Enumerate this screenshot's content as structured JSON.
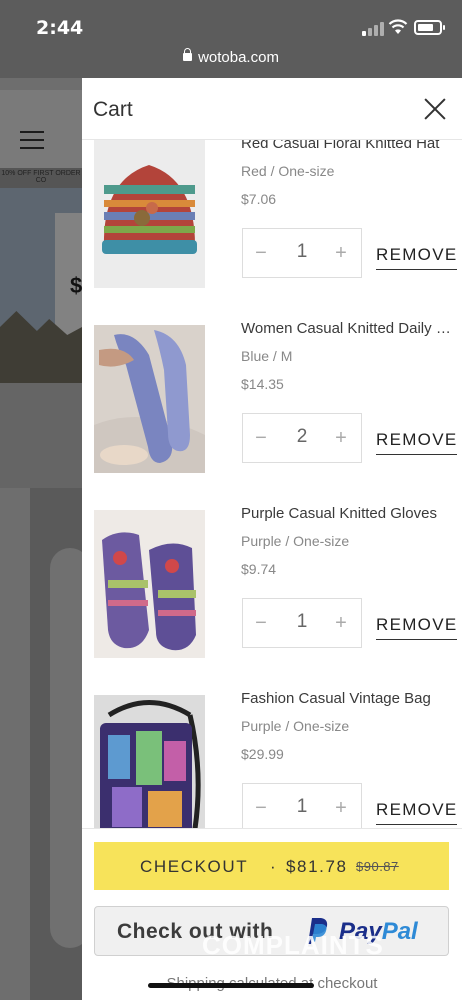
{
  "status": {
    "time": "2:44",
    "url": "wotoba.com"
  },
  "background": {
    "promo": "10% OFF FIRST ORDER CO",
    "hero_symbol": "$"
  },
  "cart": {
    "title": "Cart",
    "items": [
      {
        "name": "Red Casual Floral Knitted Hat",
        "variant": "Red / One-size",
        "price": "$7.06",
        "qty": "1",
        "minus": "−",
        "plus": "+",
        "remove": "REMOVE",
        "image": "knitted-hat-image"
      },
      {
        "name": "Women Casual Knitted Daily Socks",
        "variant": "Blue / M",
        "price": "$14.35",
        "qty": "2",
        "minus": "−",
        "plus": "+",
        "remove": "REMOVE",
        "image": "knitted-socks-image"
      },
      {
        "name": "Purple Casual Knitted Gloves",
        "variant": "Purple / One-size",
        "price": "$9.74",
        "qty": "1",
        "minus": "−",
        "plus": "+",
        "remove": "REMOVE",
        "image": "knitted-gloves-image"
      },
      {
        "name": "Fashion Casual Vintage Bag",
        "variant": "Purple / One-size",
        "price": "$29.99",
        "qty": "1",
        "minus": "−",
        "plus": "+",
        "remove": "REMOVE",
        "image": "vintage-bag-image"
      }
    ],
    "checkout": {
      "label": "CHECKOUT",
      "separator": "·",
      "total": "$81.78",
      "original": "$90.87"
    },
    "paypal": {
      "prefix": "Check out with",
      "brand_a": "Pay",
      "brand_b": "Pal"
    },
    "shipping_note": "Shipping calculated at checkout"
  },
  "watermark": "COMPLAINTS",
  "colors": {
    "checkout_bg": "#f7e35a",
    "paypal_navy": "#1a2e8a",
    "paypal_blue": "#2e8ad6"
  }
}
